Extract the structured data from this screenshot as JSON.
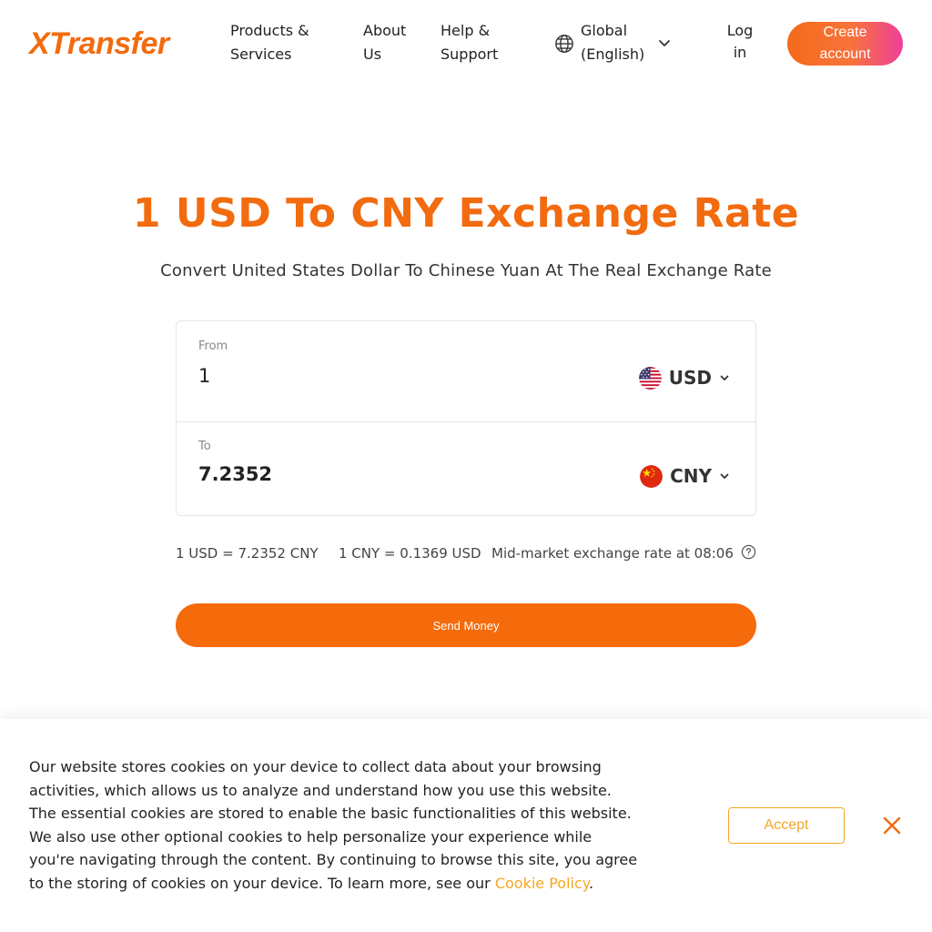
{
  "header": {
    "logo": "XTransfer",
    "nav": {
      "products": "Products & Services",
      "about": "About Us",
      "help": "Help & Support"
    },
    "language": "Global (English)",
    "login": "Log in",
    "create_account": "Create account"
  },
  "hero": {
    "title": "1 USD To CNY Exchange Rate",
    "subtitle": "Convert United States Dollar To Chinese Yuan At The Real Exchange Rate"
  },
  "converter": {
    "from_label": "From",
    "from_value": "1",
    "from_currency": "USD",
    "to_label": "To",
    "to_value": "7.2352",
    "to_currency": "CNY"
  },
  "rates": {
    "usd_to_cny": "1 USD = 7.2352 CNY",
    "cny_to_usd": "1 CNY = 0.1369 USD",
    "mid_market": "Mid-market exchange rate at 08:06"
  },
  "send_money": "Send Money",
  "cookie": {
    "text": "Our website stores cookies on your device to collect data about your browsing activities, which allows us to analyze and understand how you use this website. The essential cookies are stored to enable the basic functionalities of this website. We also use other optional cookies to help personalize your experience while you're navigating through the content. By continuing to browse this site, you agree to the storing of cookies on your device. To learn more, see our ",
    "link": "Cookie Policy",
    "end": ".",
    "accept": "Accept"
  },
  "colors": {
    "brand_orange": "#f26b0f",
    "button_orange": "#f56a0a",
    "cookie_accent": "#f5a623"
  },
  "icons": {
    "language": "globe-icon",
    "dropdown": "chevron-down-icon",
    "help": "question-circle-icon",
    "close": "close-icon"
  }
}
